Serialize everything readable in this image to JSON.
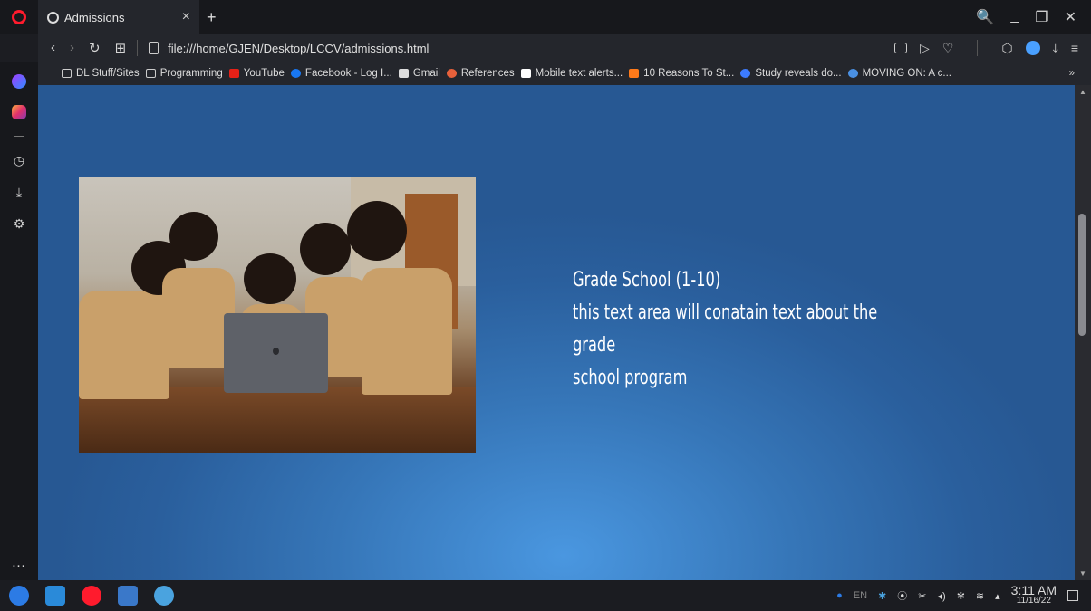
{
  "browser": {
    "tab_title": "Admissions",
    "tab_close": "×",
    "new_tab": "+",
    "url": "file:///home/GJEN/Desktop/LCCV/admissions.html",
    "window_controls": [
      "🔍",
      "_",
      "❐",
      "✕"
    ]
  },
  "bookmarks": [
    {
      "label": "DL Stuff/Sites",
      "icon": "folder-icon"
    },
    {
      "label": "Programming",
      "icon": "folder-icon"
    },
    {
      "label": "YouTube",
      "icon": "youtube-icon",
      "color": "#e62117"
    },
    {
      "label": "Facebook - Log I...",
      "icon": "facebook-icon",
      "color": "#1877f2"
    },
    {
      "label": "Gmail",
      "icon": "gmail-icon",
      "color": "#dddddd"
    },
    {
      "label": "References",
      "icon": "references-icon",
      "color": "#e8613b"
    },
    {
      "label": "Mobile text alerts...",
      "icon": "w-icon",
      "color": "#ffffff"
    },
    {
      "label": "10 Reasons To St...",
      "icon": "check-icon",
      "color": "#ff7a1a"
    },
    {
      "label": "Study reveals do...",
      "icon": "study-icon",
      "color": "#3c7bff"
    },
    {
      "label": "MOVING ON: A c...",
      "icon": "moving-icon",
      "color": "#4a90e2"
    }
  ],
  "bookmarks_more": "»",
  "page": {
    "heading": "Grade School (1-10)",
    "body_line1": "this text area will conatain text about the grade",
    "body_line2": "school program",
    "background_color": "#2a5f9d",
    "accent_color": "#4a97e0"
  },
  "taskbar": {
    "time": "3:11 AM",
    "date": "11/16/22",
    "lang": "EN"
  }
}
